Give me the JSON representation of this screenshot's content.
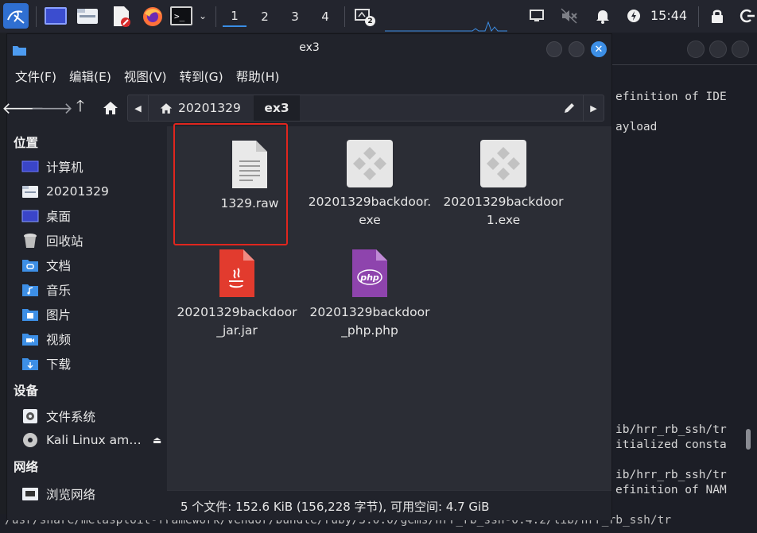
{
  "taskbar": {
    "workspaces": [
      "1",
      "2",
      "3",
      "4"
    ],
    "active_workspace": "1",
    "notification_count": "2",
    "clock": "15:44",
    "icons": [
      "kali-menu-icon",
      "desktop-icon",
      "file-manager-icon",
      "text-editor-icon",
      "firefox-icon",
      "terminal-icon",
      "chevron-down-icon",
      "screenshot-icon",
      "display-icon",
      "mute-icon",
      "bell-icon",
      "power-icon",
      "lock-icon",
      "logout-icon"
    ]
  },
  "window": {
    "title": "ex3",
    "menu": [
      "文件(F)",
      "编辑(E)",
      "视图(V)",
      "转到(G)",
      "帮助(H)"
    ],
    "breadcrumbs": [
      "20201329",
      "ex3"
    ],
    "sidebar": {
      "sections": [
        {
          "title": "位置",
          "items": [
            {
              "label": "计算机",
              "icon": "computer-icon"
            },
            {
              "label": "20201329",
              "icon": "home-folder-icon"
            },
            {
              "label": "桌面",
              "icon": "desktop-folder-icon"
            },
            {
              "label": "回收站",
              "icon": "trash-icon"
            },
            {
              "label": "文档",
              "icon": "documents-folder-icon"
            },
            {
              "label": "音乐",
              "icon": "music-folder-icon"
            },
            {
              "label": "图片",
              "icon": "pictures-folder-icon"
            },
            {
              "label": "视频",
              "icon": "videos-folder-icon"
            },
            {
              "label": "下载",
              "icon": "downloads-folder-icon"
            }
          ]
        },
        {
          "title": "设备",
          "items": [
            {
              "label": "文件系统",
              "icon": "filesystem-icon"
            },
            {
              "label": "Kali Linux am…",
              "icon": "disc-icon"
            }
          ]
        },
        {
          "title": "网络",
          "items": [
            {
              "label": "浏览网络",
              "icon": "network-icon"
            }
          ]
        }
      ]
    },
    "files": [
      {
        "line1": "1329.raw",
        "line2": "",
        "icon": "text-file-icon",
        "selected": true
      },
      {
        "line1": "20201329backdoor.",
        "line2": "exe",
        "icon": "exe-file-icon",
        "selected": false
      },
      {
        "line1": "20201329backdoor",
        "line2": "1.exe",
        "icon": "exe-file-icon",
        "selected": false
      },
      {
        "line1": "20201329backdoor",
        "line2": "_jar.jar",
        "icon": "java-file-icon",
        "selected": false
      },
      {
        "line1": "20201329backdoor",
        "line2": "_php.php",
        "icon": "php-file-icon",
        "selected": false
      }
    ],
    "status": "5 个文件: 152.6 KiB (156,228 字节), 可用空间: 4.7 GiB"
  },
  "terminal": {
    "lines": [
      "efinition of IDE",
      "ayload",
      "ib/hrr_rb_ssh/tr",
      "itialized consta",
      "ib/hrr_rb_ssh/tr",
      "efinition of NAM"
    ],
    "bottom_line": "/usr/share/metasploit-framework/vendor/bundle/ruby/3.0.0/gems/hrr_rb_ssh-0.4.2/lib/hrr_rb_ssh/tr"
  },
  "colors": {
    "accent": "#3d8fe6",
    "highlight_box": "#e0261e",
    "java_icon": "#e23b2e",
    "php_icon": "#8e44ad"
  }
}
